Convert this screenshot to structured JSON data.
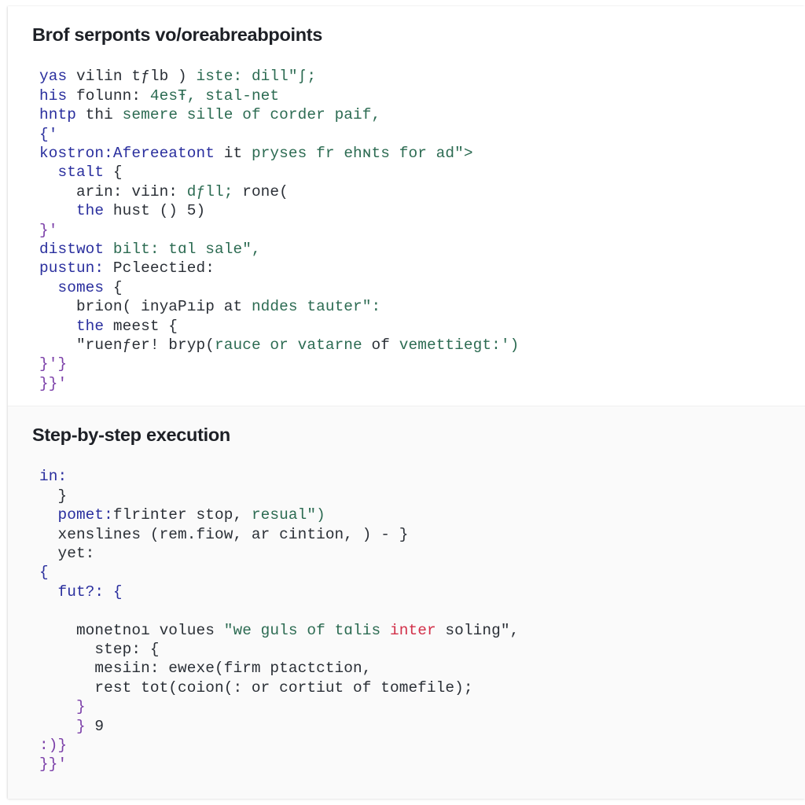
{
  "document": {
    "sections": [
      {
        "id": "breakpoints-section",
        "heading": "Brof serponts vo/oreabreabpoints",
        "code_lines": [
          {
            "indent": 0,
            "tokens": [
              {
                "t": "yas ",
                "c": "kw"
              },
              {
                "t": "vilin tƒlb ) ",
                "c": "plain"
              },
              {
                "t": "iste: dill\"ʃ;",
                "c": "str"
              }
            ]
          },
          {
            "indent": 0,
            "tokens": [
              {
                "t": "his ",
                "c": "kw"
              },
              {
                "t": "folunn: ",
                "c": "plain"
              },
              {
                "t": "4esŦ, stal-net",
                "c": "str"
              }
            ]
          },
          {
            "indent": 0,
            "tokens": [
              {
                "t": "hntp ",
                "c": "kw"
              },
              {
                "t": "thi ",
                "c": "plain"
              },
              {
                "t": "semere sille of corder paif,",
                "c": "str"
              }
            ]
          },
          {
            "indent": 0,
            "tokens": [
              {
                "t": "{'",
                "c": "kw"
              }
            ]
          },
          {
            "indent": 0,
            "tokens": [
              {
                "t": "kostron:Afereeatont ",
                "c": "kw"
              },
              {
                "t": "it ",
                "c": "plain"
              },
              {
                "t": "pryses fr ehɴts for ad\">",
                "c": "str"
              }
            ]
          },
          {
            "indent": 1,
            "tokens": [
              {
                "t": "stalt ",
                "c": "kw"
              },
              {
                "t": "{",
                "c": "plain"
              }
            ]
          },
          {
            "indent": 2,
            "tokens": [
              {
                "t": "arin: viin: ",
                "c": "plain"
              },
              {
                "t": "dƒll; ",
                "c": "str"
              },
              {
                "t": "rone(",
                "c": "plain"
              }
            ]
          },
          {
            "indent": 2,
            "tokens": [
              {
                "t": "the ",
                "c": "kw"
              },
              {
                "t": "hust () 5)",
                "c": "plain"
              }
            ]
          },
          {
            "indent": 0,
            "tokens": [
              {
                "t": "}'",
                "c": "br"
              }
            ]
          },
          {
            "indent": 0,
            "tokens": [
              {
                "t": "distwot ",
                "c": "kw"
              },
              {
                "t": "bilt: tɑl sale\",",
                "c": "str"
              }
            ]
          },
          {
            "indent": 0,
            "tokens": [
              {
                "t": "pustun: ",
                "c": "kw"
              },
              {
                "t": "Pcleectied:",
                "c": "plain"
              }
            ]
          },
          {
            "indent": 1,
            "tokens": [
              {
                "t": "somes ",
                "c": "kw"
              },
              {
                "t": "{",
                "c": "plain"
              }
            ]
          },
          {
            "indent": 2,
            "tokens": [
              {
                "t": "brion( inyaPıip at ",
                "c": "plain"
              },
              {
                "t": "nddes tauter\":",
                "c": "str"
              }
            ]
          },
          {
            "indent": 2,
            "tokens": [
              {
                "t": "the ",
                "c": "kw"
              },
              {
                "t": "meest {",
                "c": "plain"
              }
            ]
          },
          {
            "indent": 2,
            "tokens": [
              {
                "t": "\"ruenƒer! bryp(",
                "c": "plain"
              },
              {
                "t": "rauce or vatarne ",
                "c": "str"
              },
              {
                "t": "of ",
                "c": "plain"
              },
              {
                "t": "vemettiegt:')",
                "c": "str"
              }
            ]
          },
          {
            "indent": 0,
            "tokens": [
              {
                "t": "}'}",
                "c": "br"
              }
            ]
          },
          {
            "indent": -1,
            "tokens": [
              {
                "t": "}}'",
                "c": "br"
              }
            ]
          }
        ]
      },
      {
        "id": "step-execution-section",
        "heading": "Step-by-step execution",
        "code_lines": [
          {
            "indent": 0,
            "tokens": [
              {
                "t": "in:",
                "c": "kw"
              }
            ]
          },
          {
            "indent": 1,
            "tokens": [
              {
                "t": "}",
                "c": "plain"
              }
            ]
          },
          {
            "indent": 1,
            "tokens": [
              {
                "t": "pomet:",
                "c": "kw"
              },
              {
                "t": "flrinter stop, ",
                "c": "plain"
              },
              {
                "t": "resual\")",
                "c": "str"
              }
            ]
          },
          {
            "indent": 1,
            "tokens": [
              {
                "t": "xenslines (rem.fiow, ar cintion, ) - }",
                "c": "plain"
              }
            ]
          },
          {
            "indent": 1,
            "tokens": [
              {
                "t": "yet:",
                "c": "plain"
              }
            ]
          },
          {
            "indent": 0,
            "tokens": [
              {
                "t": "{",
                "c": "kw"
              }
            ]
          },
          {
            "indent": 1,
            "tokens": [
              {
                "t": "fut?: {",
                "c": "kw"
              }
            ]
          },
          {
            "indent": 0,
            "tokens": [
              {
                "t": "",
                "c": "plain"
              }
            ]
          },
          {
            "indent": 2,
            "tokens": [
              {
                "t": "monetnoı volues ",
                "c": "plain"
              },
              {
                "t": "\"we guls of tɑlis ",
                "c": "str"
              },
              {
                "t": "inter",
                "c": "err"
              },
              {
                "t": " soling\",",
                "c": "plain"
              }
            ]
          },
          {
            "indent": 3,
            "tokens": [
              {
                "t": "step: {",
                "c": "plain"
              }
            ]
          },
          {
            "indent": 3,
            "tokens": [
              {
                "t": "mesiin: ewexe(firm ptactction,",
                "c": "plain"
              }
            ]
          },
          {
            "indent": 3,
            "tokens": [
              {
                "t": "rest tot(coion(: or cortiut of tomefile);",
                "c": "plain"
              }
            ]
          },
          {
            "indent": 2,
            "tokens": [
              {
                "t": "}",
                "c": "br"
              }
            ]
          },
          {
            "indent": 2,
            "tokens": [
              {
                "t": "} ",
                "c": "br"
              },
              {
                "t": "9",
                "c": "plain"
              }
            ]
          },
          {
            "indent": 0,
            "tokens": [
              {
                "t": ":)}",
                "c": "br"
              }
            ]
          },
          {
            "indent": -1,
            "tokens": [
              {
                "t": "}}'",
                "c": "br"
              }
            ]
          }
        ]
      }
    ]
  },
  "theme": {
    "card_background": "#ffffff",
    "section_alt_background": "#fafafa",
    "heading_color": "#1d2026",
    "code_default_color": "#2a2f36",
    "token_keyword_color": "#2a2f9e",
    "token_string_color": "#2c6b52",
    "token_bracket_color": "#7b3fa8",
    "token_error_color": "#d23049"
  }
}
